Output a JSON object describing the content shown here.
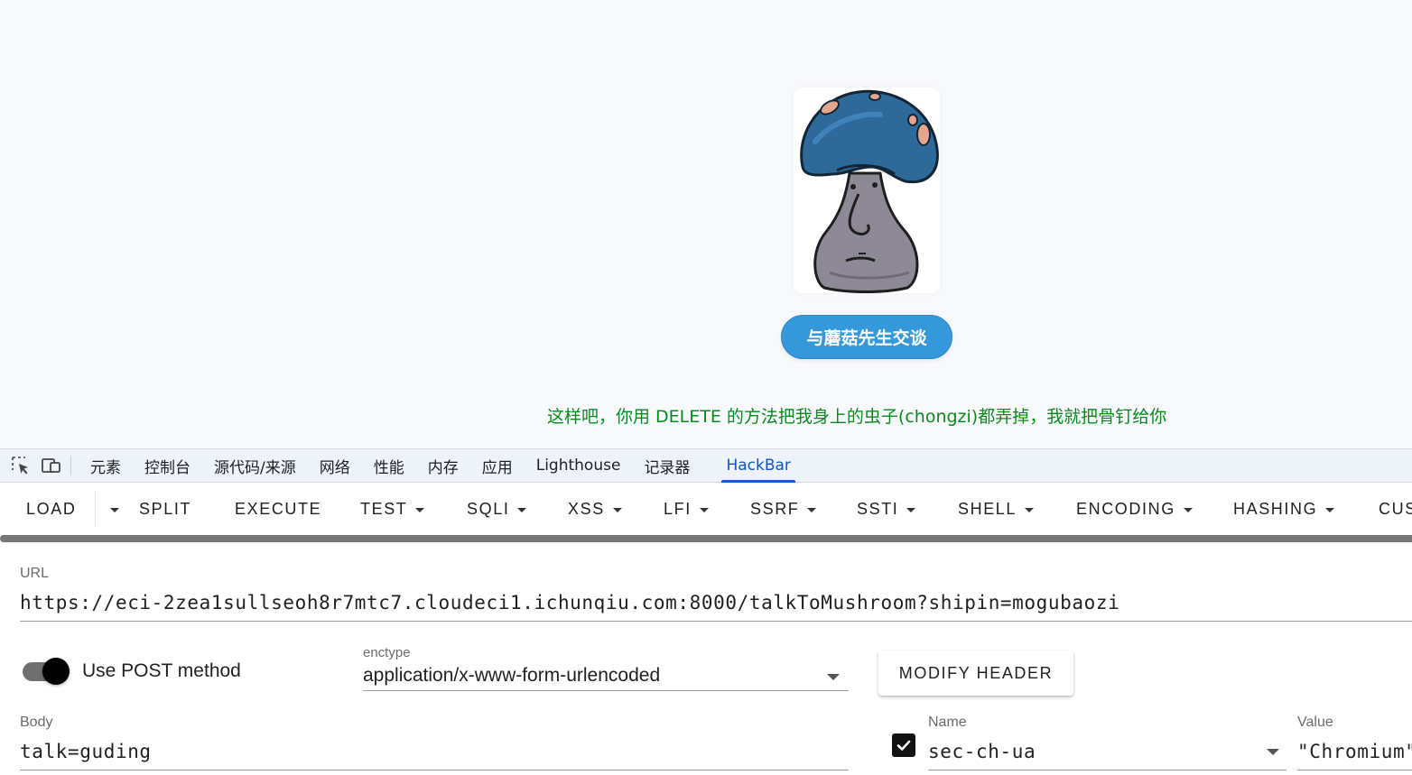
{
  "page": {
    "talk_button": "与蘑菇先生交谈",
    "response": "这样吧，你用 DELETE 的方法把我身上的虫子(chongzi)都弄掉，我就把骨钉给你"
  },
  "devtools": {
    "tabs": [
      {
        "label": "元素"
      },
      {
        "label": "控制台"
      },
      {
        "label": "源代码/来源"
      },
      {
        "label": "网络"
      },
      {
        "label": "性能"
      },
      {
        "label": "内存"
      },
      {
        "label": "应用"
      },
      {
        "label": "Lighthouse"
      },
      {
        "label": "记录器"
      },
      {
        "label": "HackBar",
        "active": true
      }
    ]
  },
  "hackbar": {
    "toolbar": {
      "load": "LOAD",
      "split": "SPLIT",
      "execute": "EXECUTE",
      "test": "TEST",
      "sqli": "SQLI",
      "xss": "XSS",
      "lfi": "LFI",
      "ssrf": "SSRF",
      "ssti": "SSTI",
      "shell": "SHELL",
      "encoding": "ENCODING",
      "hashing": "HASHING",
      "custom": "CUS"
    },
    "url_label": "URL",
    "url_value": "https://eci-2zea1sullseoh8r7mtc7.cloudeci1.ichunqiu.com:8000/talkToMushroom?shipin=mogubaozi",
    "use_post_label": "Use POST method",
    "use_post_enabled": true,
    "enctype_label": "enctype",
    "enctype_value": "application/x-www-form-urlencoded",
    "modify_header": "MODIFY HEADER",
    "body_label": "Body",
    "body_value": "talk=guding",
    "header": {
      "enabled": true,
      "name_label": "Name",
      "name_value": "sec-ch-ua",
      "value_label": "Value",
      "value_value": "\"Chromium\""
    }
  },
  "colors": {
    "talk_button": "#3498db",
    "response_text": "#0a8a1e",
    "active_tab": "#0b57d0"
  }
}
